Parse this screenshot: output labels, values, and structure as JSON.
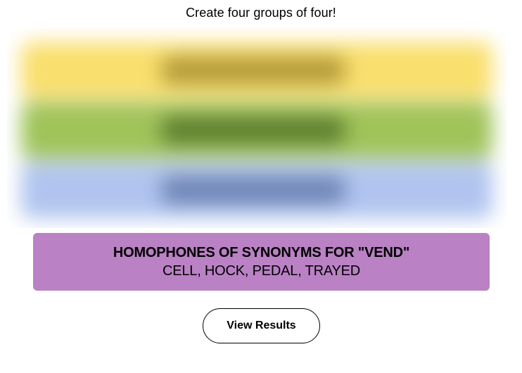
{
  "header": {
    "instructions": "Create four groups of four!"
  },
  "board": {
    "blurred_groups": [
      {
        "name": "yellow",
        "color": "#f9df6d"
      },
      {
        "name": "green",
        "color": "#a0c35a"
      },
      {
        "name": "blue",
        "color": "#b0c4ef"
      }
    ]
  },
  "solved_group": {
    "title": "HOMOPHONES OF SYNONYMS FOR \"VEND\"",
    "members": "CELL, HOCK, PEDAL, TRAYED",
    "color": "#ba81c5"
  },
  "actions": {
    "view_results_label": "View Results"
  }
}
